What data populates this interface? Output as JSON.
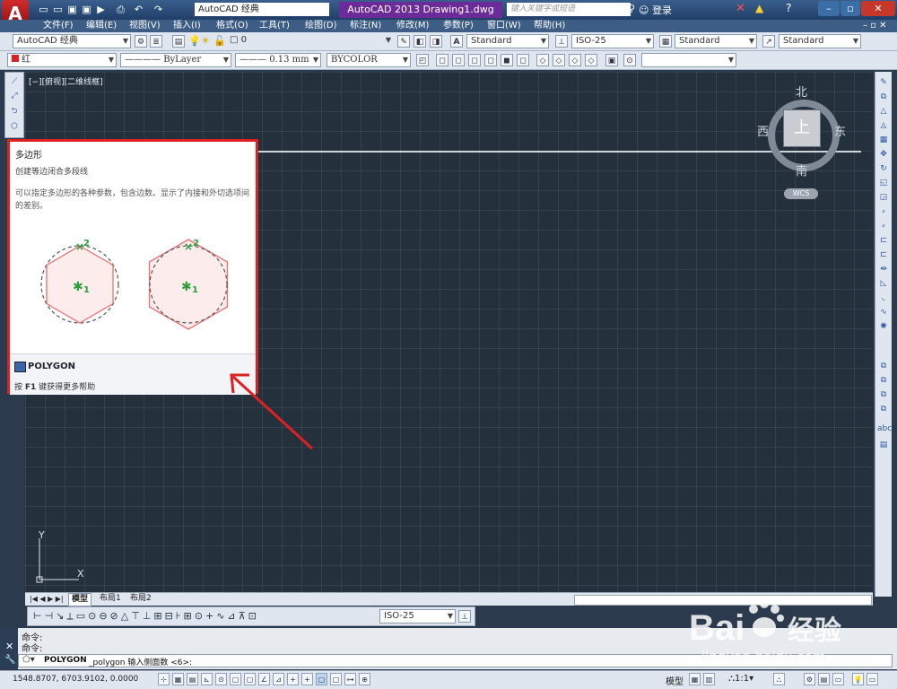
{
  "titlebar": {
    "workspace_mini": "AutoCAD 经典",
    "title": "AutoCAD 2013    Drawing1.dwg",
    "search_placeholder": "键入关键字或短语",
    "login": "登录",
    "app_logo": "A"
  },
  "menu": {
    "items": [
      "文件(F)",
      "编辑(E)",
      "视图(V)",
      "插入(I)",
      "格式(O)",
      "工具(T)",
      "绘图(D)",
      "标注(N)",
      "修改(M)",
      "参数(P)",
      "窗口(W)",
      "帮助(H)"
    ]
  },
  "toolbar1": {
    "workspace": "AutoCAD 经典",
    "layer": "0",
    "text_style": "Standard",
    "dim_style": "ISO-25",
    "table_style": "Standard",
    "multileader_style": "Standard"
  },
  "toolbar2": {
    "color": "红",
    "linetype": "ByLayer",
    "lineweight": "0.13 mm",
    "plotstyle": "BYCOLOR"
  },
  "viewport": {
    "label": "[−][俯视][二维线框]"
  },
  "viewcube": {
    "north": "北",
    "south": "南",
    "east": "东",
    "west": "西",
    "face": "上",
    "wcs": "WCS"
  },
  "tooltip": {
    "title": "多边形",
    "subtitle": "创建等边闭合多段线",
    "description": "可以指定多边形的各种参数，包含边数。显示了内接和外切选项间的差别。",
    "command": "POLYGON",
    "help_prefix": "按 ",
    "help_key": "F1",
    "help_suffix": " 键获得更多帮助",
    "point1": "1",
    "point2": "2"
  },
  "ucs": {
    "x": "X",
    "y": "Y"
  },
  "layout_tabs": [
    "模型",
    "布局1",
    "布局2"
  ],
  "dim_toolbar": {
    "dim_style": "ISO-25"
  },
  "command": {
    "history": [
      "命令:",
      "命令:"
    ],
    "prompt_cmd": "POLYGON",
    "prompt_text": " _polygon 输入侧面数 <6>:"
  },
  "status": {
    "coords": "1548.8707,   6703.9102,  0.0000",
    "model_label": "模型",
    "scale": "1:1"
  },
  "watermark": {
    "brand": "Bai",
    "brand_cn": "经验",
    "url": "jingyan.baidu.com"
  },
  "colors": {
    "accent": "#e02020",
    "canvas": "#25303d",
    "title_highlight": "#6d2b9a",
    "green_marker": "#2aa03c"
  }
}
